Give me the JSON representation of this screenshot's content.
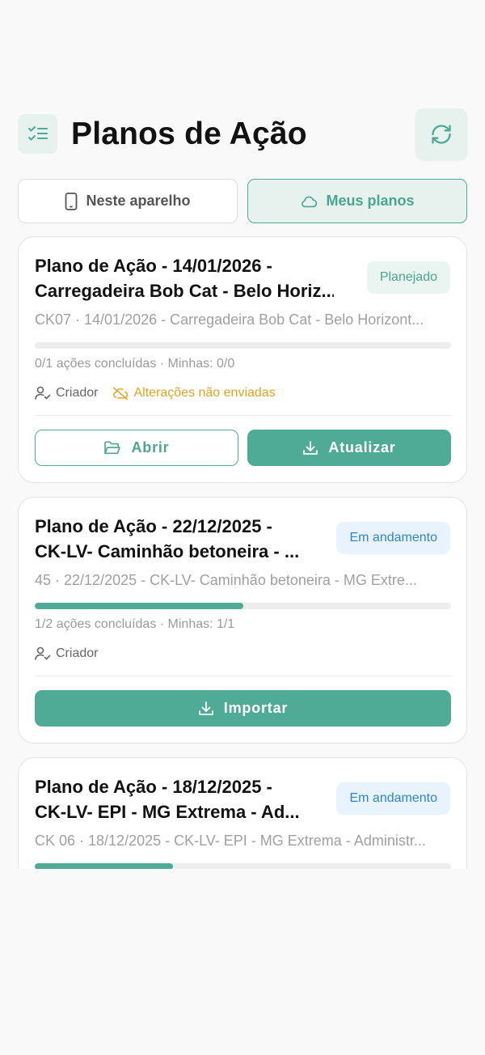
{
  "header": {
    "title": "Planos de Ação"
  },
  "tabs": [
    {
      "label": "Neste aparelho",
      "icon": "smartphone-icon",
      "active": false
    },
    {
      "label": "Meus planos",
      "icon": "cloud-icon",
      "active": true
    }
  ],
  "colors": {
    "accent": "#4fab95",
    "accent_light": "#e7f2ee",
    "warning": "#e0a422",
    "info": "#2f86c6",
    "background": "#f9f9f9"
  },
  "plans": [
    {
      "title_line1": "Plano de Ação - 14/01/2026 -",
      "title_line2": "Carregadeira Bob Cat - Belo Horiz...",
      "status": "Planejado",
      "subtitle": "CK07 · 14/01/2026 - Carregadeira Bob Cat - Belo Horizont...",
      "progress": 0.0,
      "stats": "0/1 ações concluídas · Minhas: 0/0",
      "role": "Criador",
      "warning": "Alterações não enviadas",
      "open_label": "Abrir",
      "update_label": "Atualizar"
    },
    {
      "title_line1": "Plano de Ação - 22/12/2025 -",
      "title_line2": "CK-LV- Caminhão betoneira - ...",
      "status": "Em andamento",
      "subtitle": "45 · 22/12/2025 - CK-LV- Caminhão betoneira - MG Extre...",
      "progress": 0.5,
      "stats": "1/2 ações concluídas · Minhas: 1/1",
      "role": "Criador",
      "import_label": "Importar"
    },
    {
      "title_line1": "Plano de Ação - 18/12/2025 -",
      "title_line2": "CK-LV- EPI - MG Extrema - Ad...",
      "status": "Em andamento",
      "subtitle": "CK 06 · 18/12/2025 - CK-LV- EPI - MG Extrema - Administr...",
      "progress": 0.333
    }
  ]
}
